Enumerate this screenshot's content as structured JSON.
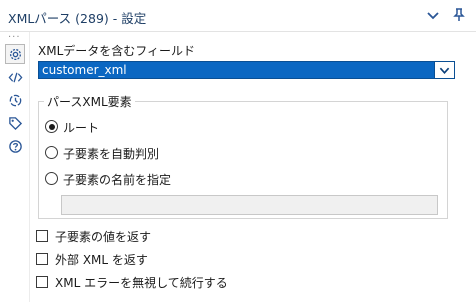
{
  "header": {
    "title": "XMLパース (289) - 設定",
    "icons": [
      "chevron-down-icon",
      "pin-icon"
    ]
  },
  "sidebar": {
    "dots": "···",
    "icons": [
      "gear-icon",
      "code-icon",
      "target-icon",
      "tag-icon",
      "help-icon"
    ],
    "active": "gear-icon"
  },
  "form": {
    "field_label": "XMLデータを含むフィールド",
    "field_value": "customer_xml",
    "group_title": "パースXML要素",
    "radios": [
      {
        "label": "ルート",
        "selected": true
      },
      {
        "label": "子要素を自動判別",
        "selected": false
      },
      {
        "label": "子要素の名前を指定",
        "selected": false
      }
    ],
    "child_name_value": "",
    "checkboxes": [
      {
        "label": "子要素の値を返す",
        "checked": false
      },
      {
        "label": "外部 XML を返す",
        "checked": false
      },
      {
        "label": "XML エラーを無視して続行する",
        "checked": false
      }
    ]
  },
  "colors": {
    "title_text": "#1f3f66",
    "select_bg": "#0b67c2",
    "icon_blue": "#2b5797"
  }
}
